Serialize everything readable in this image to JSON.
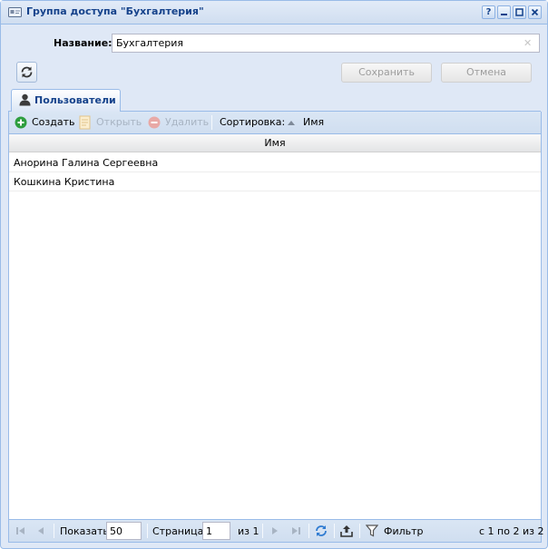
{
  "window": {
    "title": "Группа доступа \"Бухгалтерия\"",
    "tools": {
      "help": "?",
      "minimize": "–",
      "maximize": "□",
      "close": "✕"
    }
  },
  "form": {
    "name_label": "Название:",
    "name_value": "Бухгалтерия",
    "save_label": "Сохранить",
    "cancel_label": "Отмена"
  },
  "tabs": [
    {
      "label": "Пользователи",
      "icon": "user-icon",
      "active": true
    }
  ],
  "toolbar": {
    "create_label": "Создать",
    "open_label": "Открыть",
    "delete_label": "Удалить",
    "sort_label": "Сортировка:",
    "sort_field": "Имя"
  },
  "grid": {
    "columns": [
      "Имя"
    ],
    "rows": [
      [
        "Анорина Галина Сергеевна"
      ],
      [
        "Кошкина Кристина"
      ]
    ]
  },
  "pager": {
    "show_label": "Показать",
    "page_size": "50",
    "page_label": "Страница",
    "page_value": "1",
    "of_label": "из 1",
    "filter_label": "Фильтр",
    "summary": "с 1 по 2 из 2"
  },
  "colors": {
    "accent": "#15428b",
    "border": "#99bbe8",
    "panel": "#dfe8f6",
    "create_green": "#2e9e3e",
    "delete_red": "#d9534f"
  }
}
